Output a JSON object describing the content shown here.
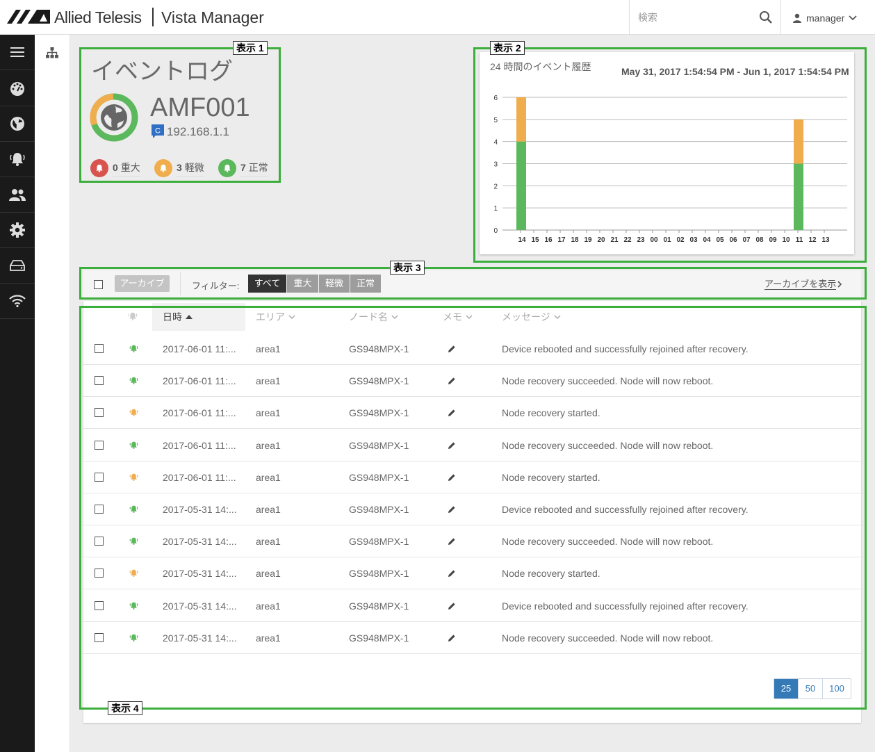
{
  "header": {
    "brand": "Allied Telesis",
    "app_name": "Vista Manager",
    "search_placeholder": "検索",
    "user": "manager"
  },
  "sidebar": {
    "items": [
      "menu-icon",
      "dashboard-icon",
      "globe-icon",
      "alarm-bell-icon",
      "users-icon",
      "gear-icon",
      "storage-icon",
      "wifi-icon"
    ]
  },
  "callouts": {
    "p1": "表示 1",
    "p2": "表示 2",
    "p3": "表示 3",
    "p4": "表示 4"
  },
  "panel1": {
    "title": "イベントログ",
    "device": "AMF001",
    "ip": "192.168.1.1",
    "ip_badge": "C",
    "critical": {
      "count": "0",
      "label": "重大"
    },
    "minor": {
      "count": "3",
      "label": "軽微"
    },
    "normal": {
      "count": "7",
      "label": "正常"
    }
  },
  "chart_data": {
    "type": "bar",
    "stacked": true,
    "title": "24 時間のイベント履歴",
    "subtitle": "May 31, 2017 1:54:54 PM - Jun 1, 2017 1:54:54 PM",
    "categories": [
      "14",
      "15",
      "16",
      "17",
      "18",
      "19",
      "20",
      "21",
      "22",
      "23",
      "00",
      "01",
      "02",
      "03",
      "04",
      "05",
      "06",
      "07",
      "08",
      "09",
      "10",
      "11",
      "12",
      "13"
    ],
    "series": [
      {
        "color": "#5cb85c",
        "values": [
          4,
          0,
          0,
          0,
          0,
          0,
          0,
          0,
          0,
          0,
          0,
          0,
          0,
          0,
          0,
          0,
          0,
          0,
          0,
          0,
          0,
          3,
          0,
          0
        ]
      },
      {
        "color": "#f0ad4e",
        "values": [
          2,
          0,
          0,
          0,
          0,
          0,
          0,
          0,
          0,
          0,
          0,
          0,
          0,
          0,
          0,
          0,
          0,
          0,
          0,
          0,
          0,
          2,
          0,
          0
        ]
      }
    ],
    "yticks": [
      0,
      1,
      2,
      3,
      4,
      5,
      6
    ],
    "ylim": [
      0,
      6
    ],
    "grid": true
  },
  "toolbar": {
    "archive": "アーカイブ",
    "filter_label": "フィルター:",
    "filters": [
      "すべて",
      "重大",
      "軽微",
      "正常"
    ],
    "active_filter": "すべて",
    "show_archive": "アーカイブを表示"
  },
  "table": {
    "columns": {
      "date": "日時",
      "area": "エリア",
      "node": "ノード名",
      "memo": "メモ",
      "message": "メッセージ"
    },
    "rows": [
      {
        "sev": "normal",
        "date": "2017-06-01 11:...",
        "area": "area1",
        "node": "GS948MPX-1",
        "message": "Device rebooted and successfully rejoined after recovery."
      },
      {
        "sev": "normal",
        "date": "2017-06-01 11:...",
        "area": "area1",
        "node": "GS948MPX-1",
        "message": "Node recovery succeeded. Node will now reboot."
      },
      {
        "sev": "minor",
        "date": "2017-06-01 11:...",
        "area": "area1",
        "node": "GS948MPX-1",
        "message": "Node recovery started."
      },
      {
        "sev": "normal",
        "date": "2017-06-01 11:...",
        "area": "area1",
        "node": "GS948MPX-1",
        "message": "Node recovery succeeded. Node will now reboot."
      },
      {
        "sev": "minor",
        "date": "2017-06-01 11:...",
        "area": "area1",
        "node": "GS948MPX-1",
        "message": "Node recovery started."
      },
      {
        "sev": "normal",
        "date": "2017-05-31 14:...",
        "area": "area1",
        "node": "GS948MPX-1",
        "message": "Device rebooted and successfully rejoined after recovery."
      },
      {
        "sev": "normal",
        "date": "2017-05-31 14:...",
        "area": "area1",
        "node": "GS948MPX-1",
        "message": "Node recovery succeeded. Node will now reboot."
      },
      {
        "sev": "minor",
        "date": "2017-05-31 14:...",
        "area": "area1",
        "node": "GS948MPX-1",
        "message": "Node recovery started."
      },
      {
        "sev": "normal",
        "date": "2017-05-31 14:...",
        "area": "area1",
        "node": "GS948MPX-1",
        "message": "Device rebooted and successfully rejoined after recovery."
      },
      {
        "sev": "normal",
        "date": "2017-05-31 14:...",
        "area": "area1",
        "node": "GS948MPX-1",
        "message": "Node recovery succeeded. Node will now reboot."
      }
    ]
  },
  "pagination": {
    "sizes": [
      "25",
      "50",
      "100"
    ],
    "active": "25"
  },
  "colors": {
    "critical": "#d9534f",
    "minor": "#f0ad4e",
    "normal": "#5cb85c",
    "highlight": "#3cae3c",
    "accent": "#337ab7"
  }
}
